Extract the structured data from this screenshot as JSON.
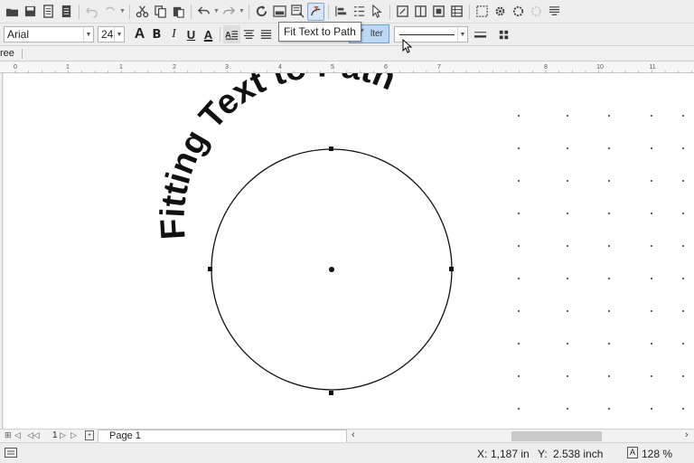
{
  "font": {
    "name": "Arial",
    "size": "24"
  },
  "tooltip": "Fit Text to Path",
  "filter_button": {
    "label": "lter"
  },
  "sidebar_tab": "ree",
  "ruler": {
    "labels": [
      "0",
      "1",
      "1",
      "2",
      "3",
      "4",
      "5",
      "6",
      "7",
      "8",
      "10",
      "11"
    ]
  },
  "canvas": {
    "curved_text": "Fitting Text to Path"
  },
  "pages": {
    "page_number": "1",
    "tab_label": "Page 1"
  },
  "status": {
    "x_label": "X:",
    "x_value": "1,187 in",
    "y_label": "Y:",
    "y_value": "2.538 inch",
    "zoom": "128 %"
  },
  "colors": {
    "accent": "#7aa7d8",
    "active_button": "#bcd8f4",
    "canvas": "#ffffff"
  }
}
